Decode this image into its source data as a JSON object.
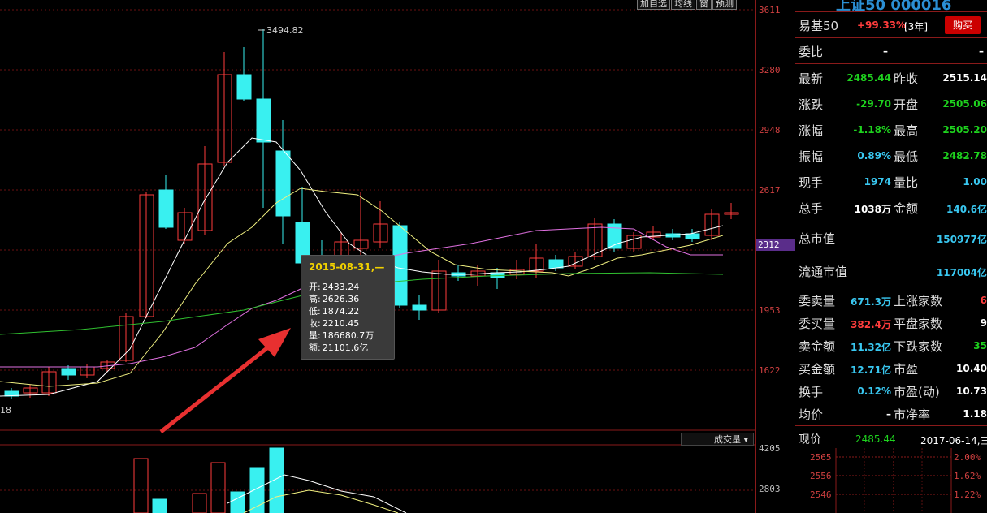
{
  "chart": {
    "y_axis_labels": [
      "3611",
      "3280",
      "2948",
      "2617",
      "1953",
      "1622"
    ],
    "current_price_tag": "2312",
    "peak_label": "3494.82",
    "left_low_label": "18",
    "volume_axis_labels": [
      "4205",
      "2803"
    ],
    "volume_selector": "成交量"
  },
  "toolbar": {
    "items": [
      "加自选",
      "均线",
      "窗",
      "预测"
    ]
  },
  "tooltip": {
    "date": "2015-08-31,—",
    "open_label": "开:",
    "open": "2433.24",
    "high_label": "高:",
    "high": "2626.36",
    "low_label": "低:",
    "low": "1874.22",
    "close_label": "收:",
    "close": "2210.45",
    "volume_label": "量:",
    "volume": "186680.7万",
    "amount_label": "额:",
    "amount": "21101.6亿"
  },
  "panel": {
    "title": "上证50 000016",
    "fund_name": "易基50",
    "fund_return": "+99.33%",
    "fund_period": "[3年]",
    "buy_button": "购买",
    "weibi_label": "委比",
    "weibi_v1": "–",
    "weibi_v2": "–",
    "rows": [
      {
        "l1": "最新",
        "v1": "2485.44",
        "c1": "green",
        "l2": "昨收",
        "v2": "2515.14",
        "c2": "white"
      },
      {
        "l1": "涨跌",
        "v1": "-29.70",
        "c1": "green",
        "l2": "开盘",
        "v2": "2505.06",
        "c2": "green"
      },
      {
        "l1": "涨幅",
        "v1": "-1.18%",
        "c1": "green",
        "l2": "最高",
        "v2": "2505.20",
        "c2": "green"
      },
      {
        "l1": "振幅",
        "v1": "0.89%",
        "c1": "cyan",
        "l2": "最低",
        "v2": "2482.78",
        "c2": "green"
      },
      {
        "l1": "现手",
        "v1": "1974",
        "c1": "cyan",
        "l2": "量比",
        "v2": "1.00",
        "c2": "cyan"
      },
      {
        "l1": "总手",
        "v1": "1038万",
        "c1": "white",
        "l2": "金额",
        "v2": "140.6亿",
        "c2": "cyan"
      }
    ],
    "mcap_label": "总市值",
    "mcap": "150977亿",
    "float_label": "流通市值",
    "float": "117004亿",
    "rows2": [
      {
        "l1": "委卖量",
        "v1": "671.3万",
        "c1": "cyan",
        "l2": "上涨家数",
        "v2": "6",
        "c2": "red"
      },
      {
        "l1": "委买量",
        "v1": "382.4万",
        "c1": "red",
        "l2": "平盘家数",
        "v2": "9",
        "c2": "white"
      },
      {
        "l1": "卖金额",
        "v1": "11.32亿",
        "c1": "cyan",
        "l2": "下跌家数",
        "v2": "35",
        "c2": "green"
      },
      {
        "l1": "买金额",
        "v1": "12.71亿",
        "c1": "cyan",
        "l2": "市盈",
        "v2": "10.40",
        "c2": "white"
      },
      {
        "l1": "换手",
        "v1": "0.12%",
        "c1": "cyan",
        "l2": "市盈(动)",
        "v2": "10.73",
        "c2": "white"
      },
      {
        "l1": "均价",
        "v1": "–",
        "c1": "white",
        "l2": "市净率",
        "v2": "1.18",
        "c2": "white"
      }
    ],
    "now_label": "现价",
    "now_price": "2485.44",
    "now_date": "2017-06-14,三",
    "mini_left": [
      "2565",
      "2556",
      "2546"
    ],
    "mini_right": [
      "2.00%",
      "1.62%",
      "1.22%"
    ]
  },
  "colors": {
    "up": "#ff3d3d",
    "down": "#39f0f0",
    "ma5": "#ffffff",
    "ma10": "#f0f080",
    "ma20": "#e070e0",
    "ma60": "#30c030"
  }
}
